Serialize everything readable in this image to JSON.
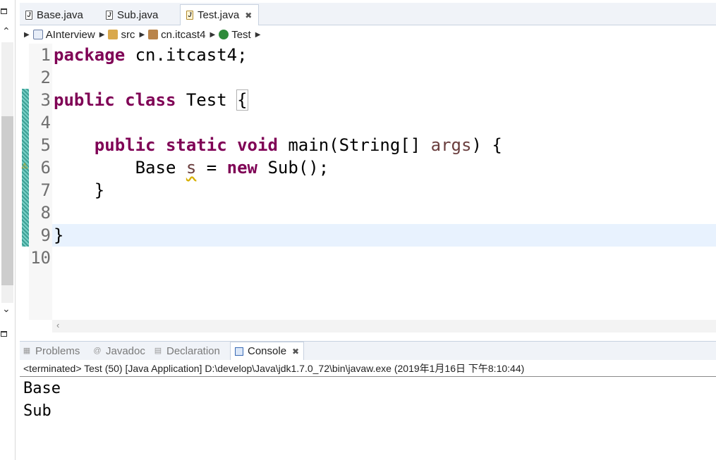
{
  "editor_tabs": [
    {
      "label": "Base.java"
    },
    {
      "label": "Sub.java"
    },
    {
      "label": "Test.java",
      "active": true
    }
  ],
  "breadcrumb": [
    {
      "label": "AInterview",
      "icon": "project-icon"
    },
    {
      "label": "src",
      "icon": "source-folder-icon"
    },
    {
      "label": "cn.itcast4",
      "icon": "package-icon"
    },
    {
      "label": "Test",
      "icon": "class-icon"
    }
  ],
  "line_numbers": [
    "1",
    "2",
    "3",
    "4",
    "5",
    "6",
    "7",
    "8",
    "9",
    "10"
  ],
  "code": {
    "l1_kw": "package",
    "l1_rest": " cn.itcast4;",
    "l3_kw1": "public",
    "l3_kw2": "class",
    "l3_name": " Test ",
    "l3_brace": "{",
    "l5_indent": "    ",
    "l5_kw1": "public",
    "l5_kw2": "static",
    "l5_kw3": "void",
    "l5_main": " main(String[] ",
    "l5_param": "args",
    "l5_end": ") {",
    "l6_indent": "        Base ",
    "l6_var": "s",
    "l6_mid": " = ",
    "l6_kw": "new",
    "l6_end": " Sub();",
    "l7": "    }",
    "l9": "}"
  },
  "panel_tabs": [
    {
      "label": "Problems",
      "icon": "problems-icon"
    },
    {
      "label": "Javadoc",
      "icon": "javadoc-icon"
    },
    {
      "label": "Declaration",
      "icon": "declaration-icon"
    },
    {
      "label": "Console",
      "icon": "console-icon",
      "active": true
    }
  ],
  "console": {
    "status": "<terminated> Test (50) [Java Application] D:\\develop\\Java\\jdk1.7.0_72\\bin\\javaw.exe (2019年1月16日 下午8:10:44)",
    "output": [
      "Base",
      "Sub"
    ]
  },
  "colors": {
    "keyword": "#7f0055",
    "parameter": "#6a3e3e",
    "current_line": "#e8f2fe",
    "change_bar": "#3c9f95"
  }
}
